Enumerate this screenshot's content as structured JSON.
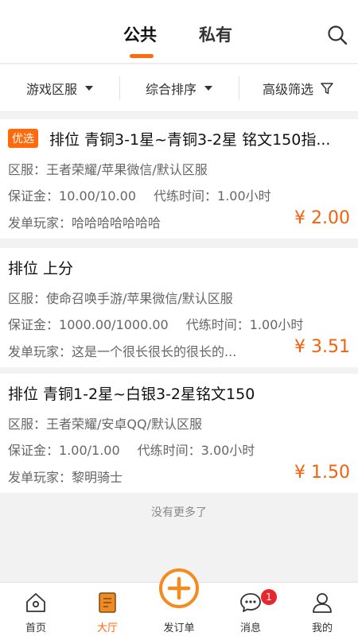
{
  "header": {
    "tabs": [
      {
        "label": "公共",
        "active": true
      },
      {
        "label": "私有",
        "active": false
      }
    ],
    "search_icon": "search-icon",
    "accent_color": "#ff6a0d"
  },
  "filters": [
    {
      "label": "游戏区服",
      "icon": "caret-down-icon"
    },
    {
      "label": "综合排序",
      "icon": "caret-down-icon"
    },
    {
      "label": "高级筛选",
      "icon": "funnel-icon"
    }
  ],
  "orders": [
    {
      "tag": "优选",
      "title": "排位 青铜3-1星~青铜3-2星 铭文150指...",
      "server_label": "区服：",
      "server": "王者荣耀/苹果微信/默认区服",
      "deposit_label": "保证金：",
      "deposit": "10.00/10.00",
      "time_label": "代练时间：",
      "time": "1.00小时",
      "player_label": "发单玩家：",
      "player": "哈哈哈哈哈哈哈",
      "price": "¥ 2.00"
    },
    {
      "title": "排位 上分",
      "server_label": "区服：",
      "server": "使命召唤手游/苹果微信/默认区服",
      "deposit_label": "保证金：",
      "deposit": "1000.00/1000.00",
      "time_label": "代练时间：",
      "time": "1.00小时",
      "player_label": "发单玩家：",
      "player": "这是一个很长很长的很长的...",
      "price": "¥ 3.51"
    },
    {
      "title": "排位 青铜1-2星~白银3-2星铭文150",
      "server_label": "区服：",
      "server": "王者荣耀/安卓QQ/默认区服",
      "deposit_label": "保证金：",
      "deposit": "1.00/1.00",
      "time_label": "代练时间：",
      "time": "3.00小时",
      "player_label": "发单玩家：",
      "player": "黎明骑士",
      "price": "¥ 1.50"
    }
  ],
  "list_end_text": "没有更多了",
  "bottom_nav": [
    {
      "label": "首页",
      "icon": "home-icon",
      "active": false
    },
    {
      "label": "大厅",
      "icon": "hall-icon",
      "active": true
    },
    {
      "label": "发订单",
      "icon": "add-order-icon",
      "active": false
    },
    {
      "label": "消息",
      "icon": "message-icon",
      "active": false,
      "badge": "1"
    },
    {
      "label": "我的",
      "icon": "profile-icon",
      "active": false
    }
  ]
}
